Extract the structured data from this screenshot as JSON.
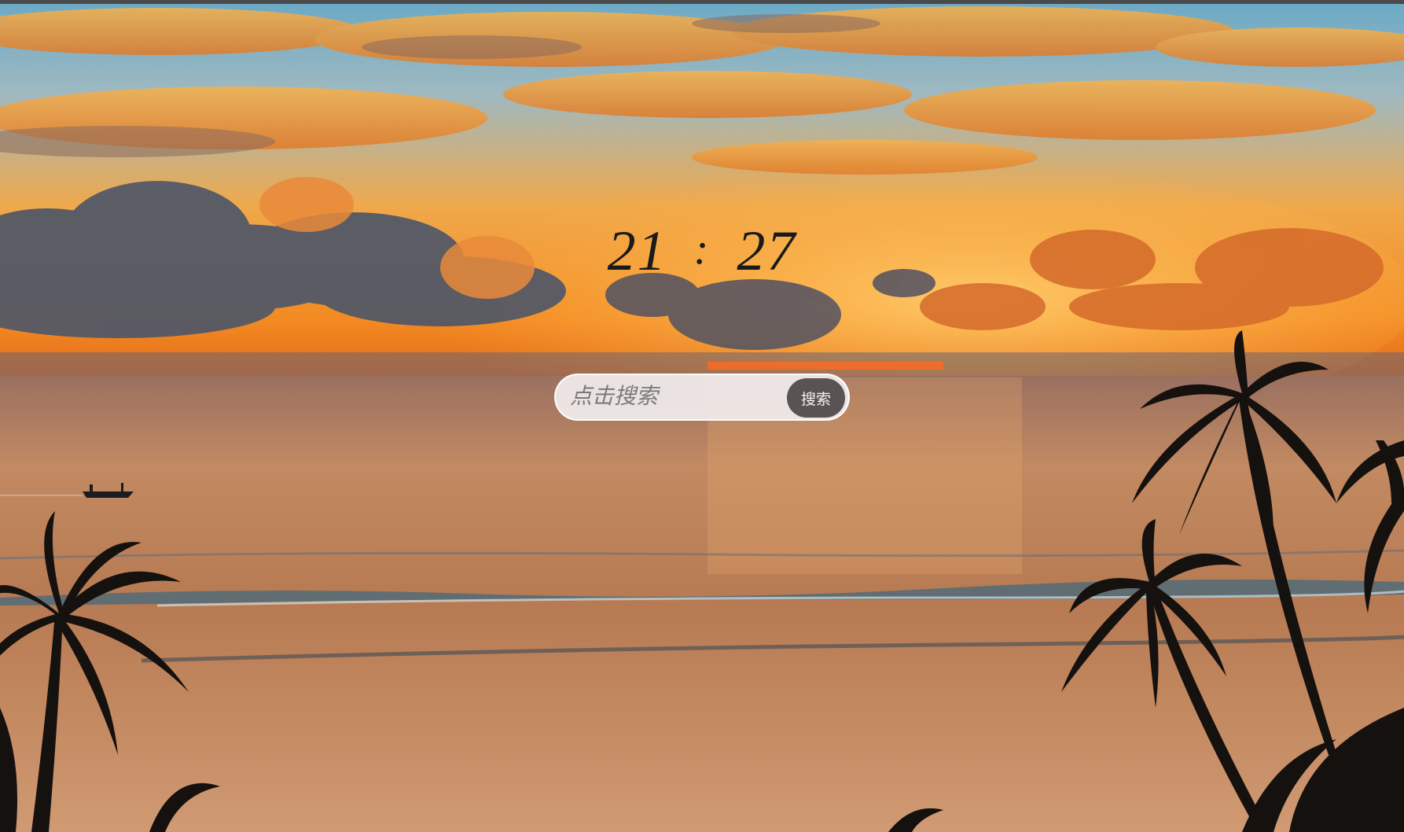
{
  "clock": {
    "hours": "21",
    "separator": ":",
    "minutes": "27"
  },
  "search": {
    "placeholder": "点击搜索",
    "button_label": "搜索"
  },
  "colors": {
    "sky_top": "#5fa8c8",
    "sunset_orange": "#f29a2e",
    "sea": "#b77a52",
    "button_bg": "#5a5354"
  }
}
